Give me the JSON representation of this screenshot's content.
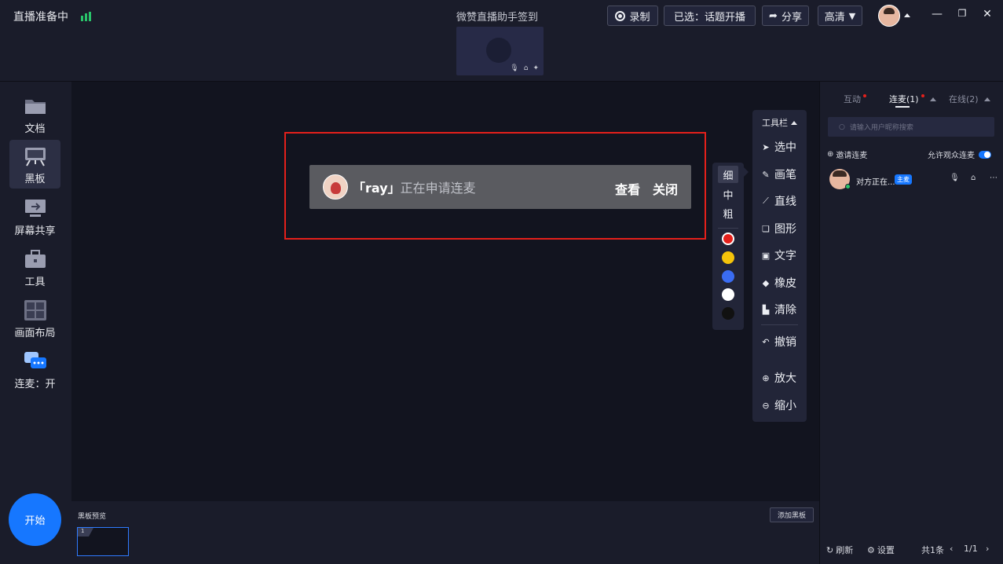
{
  "top": {
    "status": "直播准备中",
    "window_title": "微赞直播助手签到",
    "record_label": "录制",
    "selected_label": "已选：话题开播",
    "share_label": "分享",
    "quality_label": "高清"
  },
  "sidebar": {
    "items": [
      {
        "label": "文档",
        "icon": "folder-icon"
      },
      {
        "label": "黑板",
        "icon": "blackboard-icon"
      },
      {
        "label": "屏幕共享",
        "icon": "monitor-icon"
      },
      {
        "label": "工具",
        "icon": "toolbox-icon"
      },
      {
        "label": "画面布局",
        "icon": "layout-icon"
      },
      {
        "label": "连麦：开",
        "icon": "chat-icon"
      }
    ],
    "start_label": "开始"
  },
  "notification": {
    "name": "「ray」",
    "message": "正在申请连麦",
    "view_label": "查看",
    "close_label": "关闭"
  },
  "toolbar": {
    "title": "工具栏",
    "items": [
      "选中",
      "画笔",
      "直线",
      "图形",
      "文字",
      "橡皮",
      "清除",
      "撤销",
      "放大",
      "缩小"
    ]
  },
  "pen": {
    "widths": [
      "细",
      "中",
      "粗"
    ],
    "colors": [
      "#e4201b",
      "#f5c40a",
      "#3a6cf2",
      "#ffffff",
      "#111111"
    ]
  },
  "bottom": {
    "preview_label": "黑板预览",
    "add_label": "添加黑板",
    "thumb_index": "1"
  },
  "right": {
    "tabs": [
      "互动",
      "连麦(1)",
      "在线(2)"
    ],
    "search_placeholder": "请输入用户昵称搜索",
    "invite_label": "邀请连麦",
    "allow_label": "允许观众连麦",
    "member_name": "对方正在...",
    "member_badge": "主麦",
    "refresh_label": "刷新",
    "settings_label": "设置",
    "total_label": "共1条",
    "page_label": "1/1"
  }
}
